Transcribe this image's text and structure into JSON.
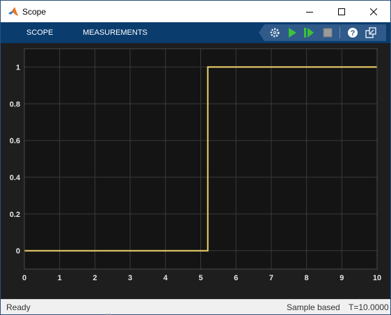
{
  "window": {
    "title": "Scope",
    "icon": "matlab-logo-icon",
    "controls": [
      "minimize-icon",
      "maximize-icon",
      "close-icon"
    ]
  },
  "toolstrip": {
    "tabs": [
      {
        "label": "SCOPE"
      },
      {
        "label": "MEASUREMENTS"
      }
    ],
    "tools": [
      "settings-gear-icon",
      "run-icon",
      "step-forward-icon",
      "stop-icon",
      "help-icon",
      "undock-icon"
    ]
  },
  "colors": {
    "toolstrip": "#0b3c6e",
    "plot_background": "#141414",
    "grid": "#3a3a3a",
    "signal": "#f2d66b",
    "tick_labels": "#e6e6e6"
  },
  "chart_data": {
    "type": "line",
    "title": "",
    "xlabel": "",
    "ylabel": "",
    "xlim": [
      0,
      10
    ],
    "ylim": [
      -0.1,
      1.1
    ],
    "xticks": [
      0,
      1,
      2,
      3,
      4,
      5,
      6,
      7,
      8,
      9,
      10
    ],
    "yticks": [
      0,
      0.2,
      0.4,
      0.6,
      0.8,
      1
    ],
    "xtick_labels": [
      "0",
      "1",
      "2",
      "3",
      "4",
      "5",
      "6",
      "7",
      "8",
      "9",
      "10"
    ],
    "ytick_labels": [
      "0",
      "0.2",
      "0.4",
      "0.6",
      "0.8",
      "1"
    ],
    "grid": true,
    "series": [
      {
        "x": [
          0,
          5.2,
          5.2,
          10
        ],
        "y": [
          0,
          0,
          1,
          1
        ]
      }
    ]
  },
  "status": {
    "ready": "Ready",
    "mode": "Sample based",
    "time": "T=10.0000"
  }
}
